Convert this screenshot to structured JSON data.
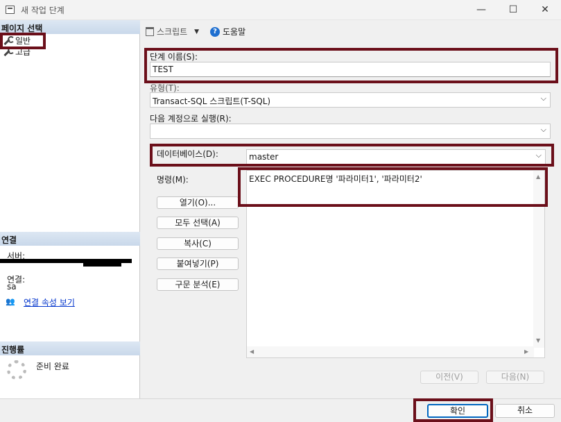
{
  "window": {
    "title": "새 작업 단계",
    "controls": [
      "—",
      "☐",
      "✕"
    ]
  },
  "left_pane": {
    "page_select_header": "페이지 선택",
    "pages": [
      {
        "label": "일반"
      },
      {
        "label": "고급"
      }
    ],
    "connection_header": "연결",
    "server_label": "서버:",
    "connection_label": "연결:",
    "connection_value": "sa",
    "view_properties_link": "연결 속성 보기",
    "progress_header": "진행률",
    "progress_status": "준비 완료"
  },
  "toolbar": {
    "script_label": "스크립트",
    "help_label": "도움말"
  },
  "form": {
    "step_name_label": "단계 이름(S):",
    "step_name_value": "TEST",
    "type_label": "유형(T):",
    "type_value": "Transact-SQL 스크립트(T-SQL)",
    "run_as_label": "다음 계정으로 실행(R):",
    "run_as_value": "",
    "database_label": "데이터베이스(D):",
    "database_value": "master",
    "command_label": "명령(M):",
    "command_value": "EXEC PROCEDURE명 '파라미터1', '파라미터2'",
    "buttons": {
      "open": "열기(O)...",
      "select_all": "모두 선택(A)",
      "copy": "복사(C)",
      "paste": "붙여넣기(P)",
      "parse": "구문 분석(E)"
    },
    "prev": "이전(V)",
    "next": "다음(N)"
  },
  "footer": {
    "ok": "확인",
    "cancel": "취소"
  },
  "colors": {
    "highlight": "#6b0f1a",
    "link": "#0033cc",
    "section_header": "#c9d8ea"
  }
}
